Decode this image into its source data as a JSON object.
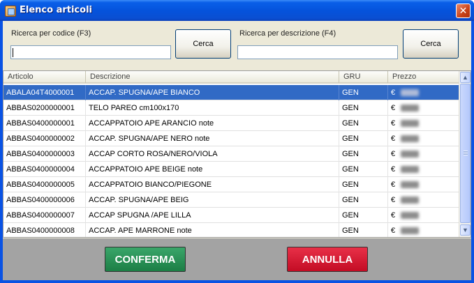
{
  "window": {
    "title": "Elenco articoli",
    "close_glyph": "✕"
  },
  "search": {
    "code_label": "Ricerca per codice (F3)",
    "code_value": "",
    "code_button": "Cerca",
    "desc_label": "Ricerca per descrizione (F4)",
    "desc_value": "",
    "desc_button": "Cerca"
  },
  "grid": {
    "columns": [
      "Articolo",
      "Descrizione",
      "GRU",
      "Prezzo"
    ],
    "currency": "€",
    "rows": [
      {
        "code": "ABALA04T4000001",
        "desc": "ACCAP. SPUGNA/APE BIANCO",
        "group": "GEN",
        "selected": true
      },
      {
        "code": "ABBAS0200000001",
        "desc": "TELO PAREO cm100x170",
        "group": "GEN"
      },
      {
        "code": "ABBAS0400000001",
        "desc": "ACCAPPATOIO APE ARANCIO note",
        "group": "GEN"
      },
      {
        "code": "ABBAS0400000002",
        "desc": "ACCAP. SPUGNA/APE NERO note",
        "group": "GEN"
      },
      {
        "code": "ABBAS0400000003",
        "desc": "ACCAP CORTO ROSA/NERO/VIOLA",
        "group": "GEN"
      },
      {
        "code": "ABBAS0400000004",
        "desc": "ACCAPPATOIO APE BEIGE note",
        "group": "GEN"
      },
      {
        "code": "ABBAS0400000005",
        "desc": "ACCAPPATOIO BIANCO/PIEGONE",
        "group": "GEN"
      },
      {
        "code": "ABBAS0400000006",
        "desc": "ACCAP. SPUGNA/APE BEIG",
        "group": "GEN"
      },
      {
        "code": "ABBAS0400000007",
        "desc": "ACCAP SPUGNA /APE LILLA",
        "group": "GEN"
      },
      {
        "code": "ABBAS0400000008",
        "desc": "ACCAP. APE MARRONE note",
        "group": "GEN"
      }
    ]
  },
  "footer": {
    "confirm_label": "CONFERMA",
    "cancel_label": "ANNULLA"
  },
  "colors": {
    "selection": "#316ac5",
    "confirm": "#1f8a4c",
    "cancel": "#d41a32"
  }
}
